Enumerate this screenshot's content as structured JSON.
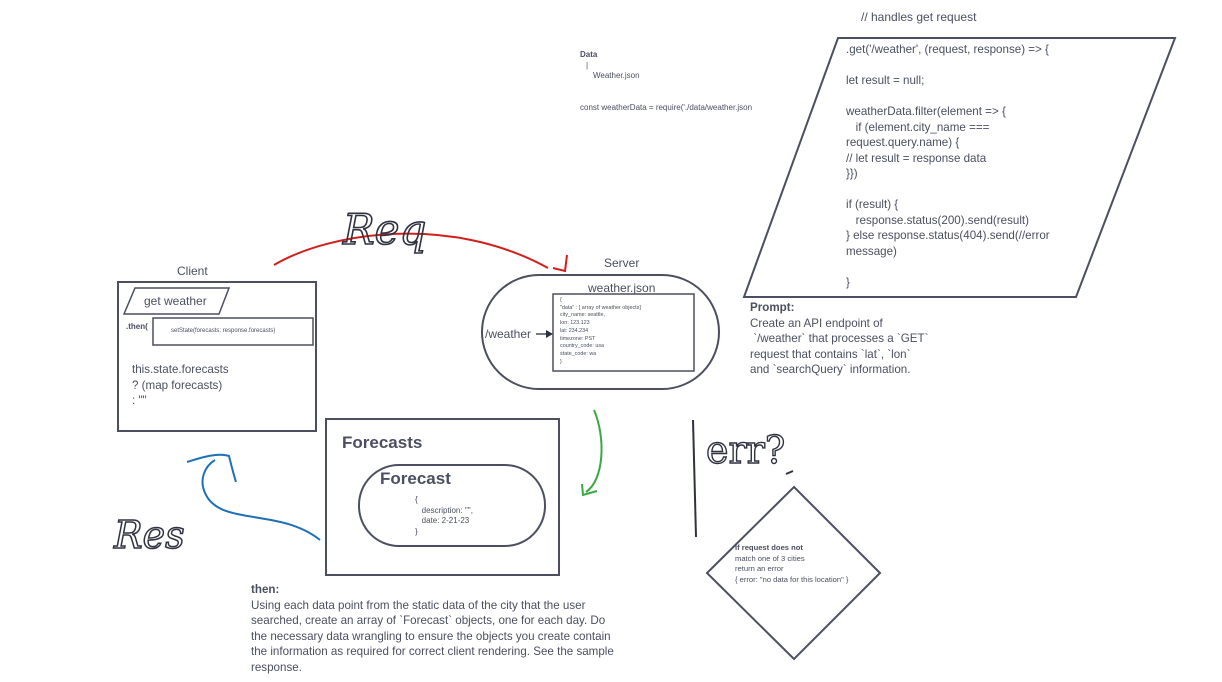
{
  "data_note": {
    "heading": "Data",
    "pipe": "|",
    "file": "Weather.json",
    "code": "const weatherData = require('./data/weather.json"
  },
  "server_code": {
    "comment": "// handles get request",
    "lines": [
      ".get('/weather', (request, response) => {",
      "",
      "let result = null;",
      "",
      "weatherData.filter(element => {",
      "   if (element.city_name ===",
      "request.query.name) {",
      "// let result = response data",
      "}})",
      "",
      "if (result) {",
      "   response.status(200).send(result)",
      "} else response.status(404).send(//error",
      "message)",
      "",
      "}"
    ]
  },
  "prompt": {
    "heading": "Prompt:",
    "lines": [
      "Create an API endpoint of",
      " `/weather` that processes a `GET`",
      "request that contains `lat`, `lon`",
      "and `searchQuery` information."
    ]
  },
  "client": {
    "title": "Client",
    "get_weather": "get weather",
    "then_label": ".then(",
    "set_state": "setState(forecasts: response.forecasts)",
    "render_lines": [
      "this.state.forecasts",
      "? (map forecasts)",
      ": \"\""
    ]
  },
  "server": {
    "title": "Server",
    "json_title": "weather.json",
    "route": "/weather",
    "json_lines": [
      "{",
      "\"data\" : [ array of weather objects]",
      "city_name: seattle,",
      "lon: 123.123",
      "lat: 234.234",
      "timezone: PST",
      "country_code: usa",
      "state_code: wa",
      "}"
    ]
  },
  "forecasts": {
    "title": "Forecasts",
    "item_title": "Forecast",
    "item_lines": [
      "{",
      "   description: '\"',",
      "   date: 2-21-23",
      "}"
    ]
  },
  "then_note": {
    "heading": "then:",
    "lines": [
      "Using each data point from the static data of the city that the user",
      "searched, create an array of `Forecast` objects, one for each day. Do",
      "the necessary data wrangling to ensure the objects you create contain",
      "the information as required for correct client rendering. See the sample",
      "response."
    ]
  },
  "error": {
    "handwritten": "err?",
    "heading": "If request does not",
    "lines": [
      "match one of 3 cities",
      "return an error",
      "{ error: \"no data for this location\" }"
    ]
  },
  "handwriting": {
    "req": "Req",
    "res": "Res"
  },
  "colors": {
    "box_stroke": "#4b4f61",
    "req_arrow": "#d0201c",
    "res_arrow": "#1f6fb8",
    "json_arrow": "#3aa844",
    "ink": "#2f3240"
  }
}
